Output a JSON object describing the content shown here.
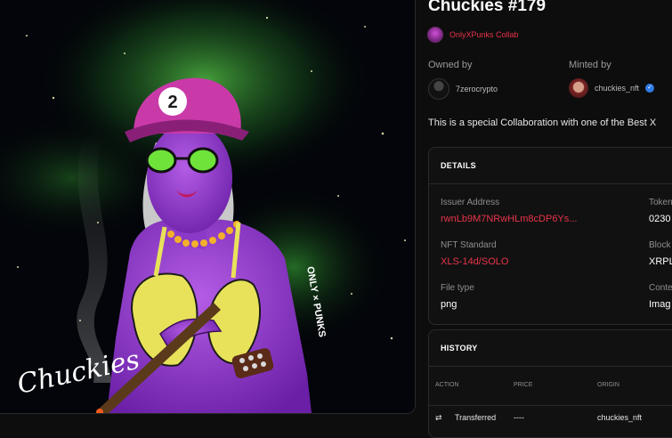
{
  "nft": {
    "title": "Chuckies #179",
    "collection": "OnlyXPunks Collab",
    "owned_by_label": "Owned by",
    "owner": "7zerocrypto",
    "minted_by_label": "Minted by",
    "minter": "chuckies_nft",
    "verified_mark": "✓",
    "description": "This is a special Collaboration with one of the Best X"
  },
  "artwork": {
    "cap_number": "2",
    "tattoo": "ONLY × PUNKS",
    "signature": "Chuckies"
  },
  "details": {
    "heading": "DETAILS",
    "fields": [
      {
        "label": "Issuer Address",
        "value": "rwnLb9M7NRwHLm8cDP6Ys..."
      },
      {
        "label": "Token",
        "value": "0230"
      },
      {
        "label": "NFT Standard",
        "value": "XLS-14d/SOLO"
      },
      {
        "label": "Block",
        "value": "XRPL"
      },
      {
        "label": "File type",
        "value": "png"
      },
      {
        "label": "Conte",
        "value": "Imag"
      }
    ]
  },
  "history": {
    "heading": "HISTORY",
    "columns": [
      "ACTION",
      "PRICE",
      "ORIGIN"
    ],
    "rows": [
      {
        "action": "Transferred",
        "price": "----",
        "origin": "chuckies_nft"
      }
    ]
  },
  "colors": {
    "accent": "#e8344a",
    "background": "#0d0d0d",
    "card": "#111111",
    "verified": "#2f7ae5"
  }
}
